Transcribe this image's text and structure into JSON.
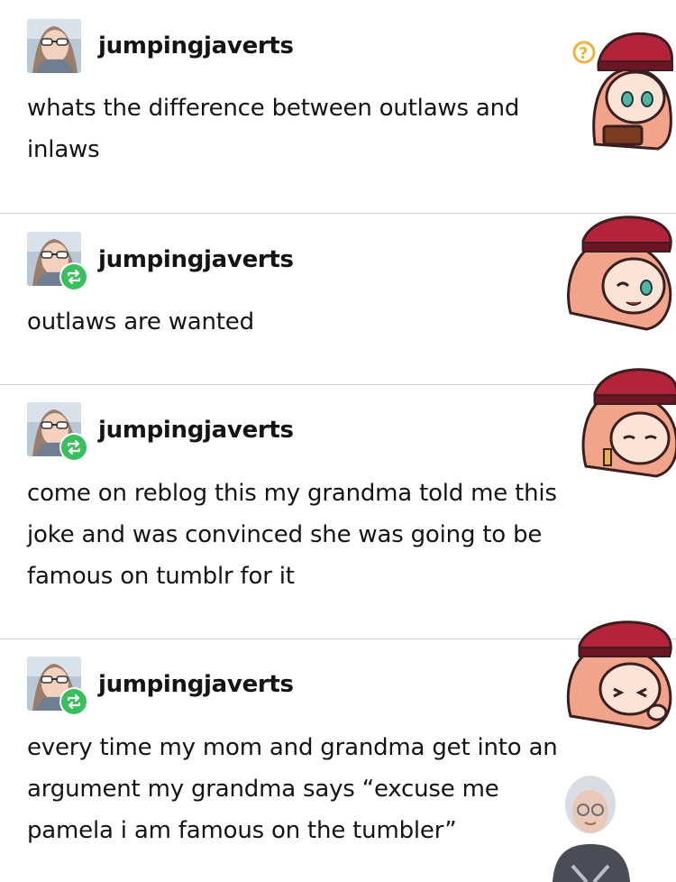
{
  "posts": [
    {
      "username": "jumpingjaverts",
      "text": "whats the difference between outlaws and\ninlaws",
      "reblogged": false
    },
    {
      "username": "jumpingjaverts",
      "text": "outlaws are wanted",
      "reblogged": true
    },
    {
      "username": "jumpingjaverts",
      "text": "come on reblog this my grandma told me this\njoke and was convinced she was going to be\nfamous on tumblr for it",
      "reblogged": true
    },
    {
      "username": "jumpingjaverts",
      "text": "every time my mom and grandma get into an\nargument my grandma says “excuse me\npamela i am famous on the tumbler”",
      "reblogged": true
    }
  ],
  "icons": {
    "avatar": "user-avatar-sunglasses",
    "reblog": "reblog-arrows-icon",
    "sticker_question": "question-mark-icon"
  },
  "colors": {
    "reblog_green": "#36c25a",
    "divider": "#cfcfcf",
    "text": "#141414",
    "sticker_hat": "#b5233a",
    "sticker_hair": "#f1a48a"
  }
}
